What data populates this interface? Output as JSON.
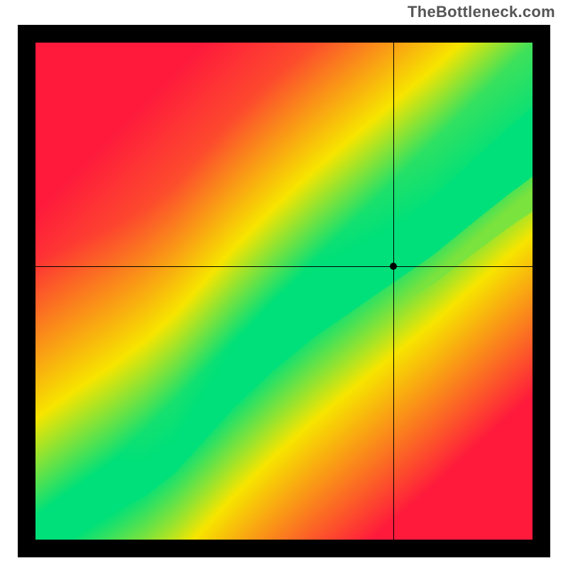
{
  "meta": {
    "watermark": "TheBottleneck.com"
  },
  "chart_data": {
    "type": "heatmap",
    "title": "",
    "xlabel": "",
    "ylabel": "",
    "x_range": [
      0,
      100
    ],
    "y_range": [
      0,
      100
    ],
    "crosshair": {
      "x": 72,
      "y": 55
    },
    "ridge": [
      {
        "x": 0,
        "y": 0
      },
      {
        "x": 8,
        "y": 4
      },
      {
        "x": 15,
        "y": 7
      },
      {
        "x": 22,
        "y": 11
      },
      {
        "x": 28,
        "y": 16
      },
      {
        "x": 34,
        "y": 23
      },
      {
        "x": 40,
        "y": 30
      },
      {
        "x": 48,
        "y": 38
      },
      {
        "x": 56,
        "y": 45
      },
      {
        "x": 64,
        "y": 51
      },
      {
        "x": 72,
        "y": 57
      },
      {
        "x": 80,
        "y": 63
      },
      {
        "x": 88,
        "y": 70
      },
      {
        "x": 95,
        "y": 76
      },
      {
        "x": 100,
        "y": 80
      }
    ],
    "ridge_width": {
      "start": 2,
      "end": 14
    },
    "color_stops": {
      "best": "#00e07a",
      "mid": "#f7e600",
      "worst": "#ff1a3c"
    },
    "annotations": []
  }
}
